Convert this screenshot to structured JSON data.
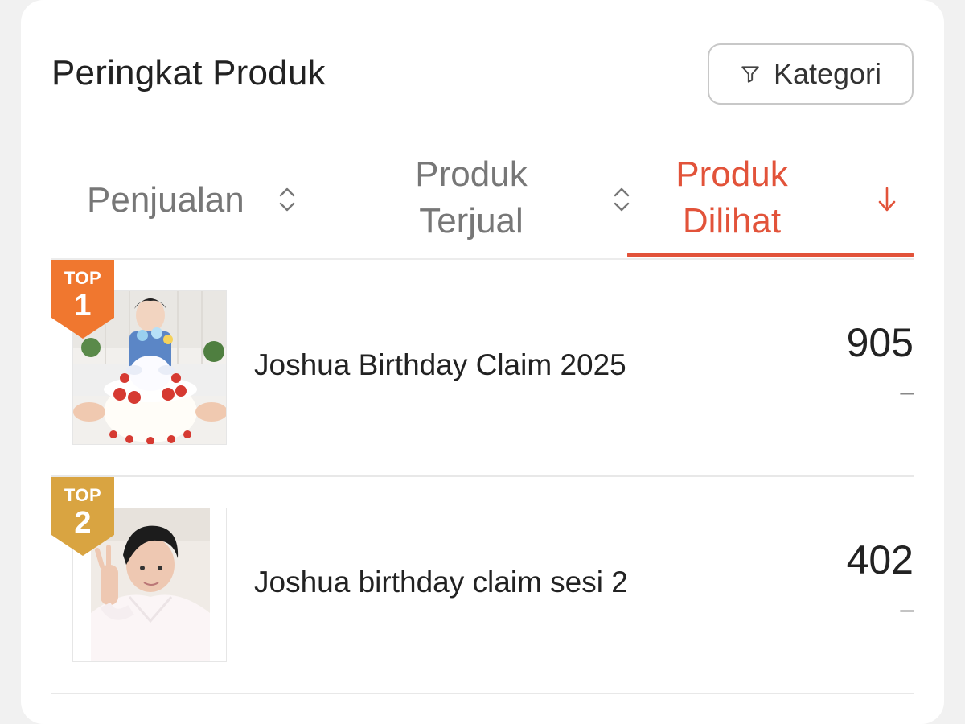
{
  "header": {
    "title": "Peringkat Produk",
    "category_button": "Kategori"
  },
  "tabs": [
    {
      "label": "Penjualan",
      "sort": "unsorted"
    },
    {
      "label": "Produk\nTerjual",
      "sort": "unsorted"
    },
    {
      "label": "Produk\nDilihat",
      "sort": "descending",
      "active": true
    }
  ],
  "colors": {
    "accent": "#e2533a",
    "badge_top1": "#f0772f",
    "badge_top2": "#d9a441"
  },
  "products": [
    {
      "badge_top": "TOP",
      "rank": "1",
      "name": "Joshua Birthday Claim 2025",
      "value": "905",
      "change": "–"
    },
    {
      "badge_top": "TOP",
      "rank": "2",
      "name": "Joshua birthday claim sesi 2",
      "value": "402",
      "change": "–"
    }
  ]
}
